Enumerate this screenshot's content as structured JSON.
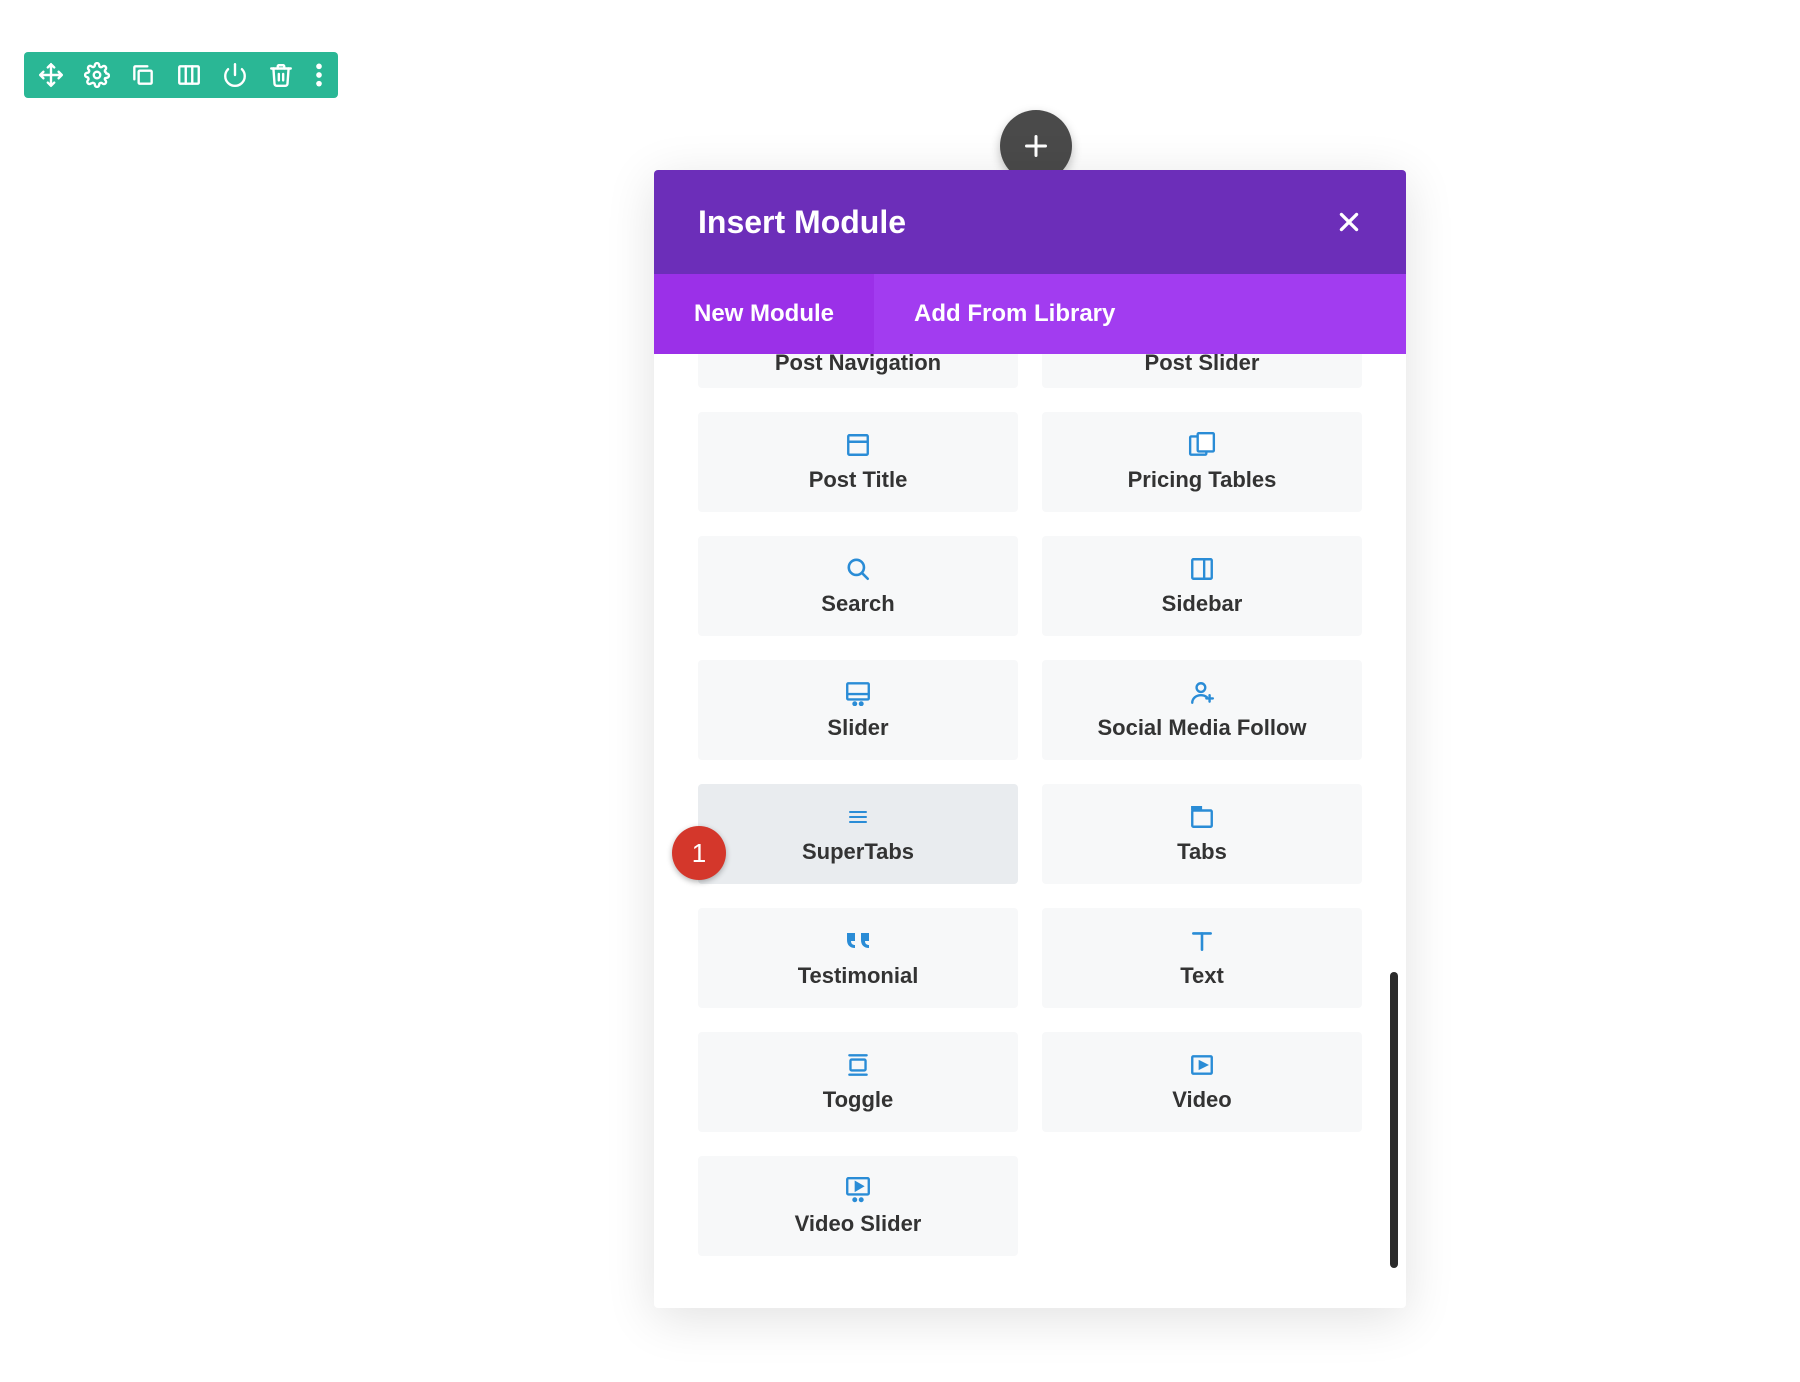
{
  "modal": {
    "title": "Insert Module",
    "tabs": [
      {
        "label": "New Module",
        "active": true
      },
      {
        "label": "Add From Library",
        "active": false
      }
    ],
    "modules": [
      {
        "label": "Post Navigation",
        "icon": "none"
      },
      {
        "label": "Post Slider",
        "icon": "none"
      },
      {
        "label": "Post Title",
        "icon": "post-title"
      },
      {
        "label": "Pricing Tables",
        "icon": "pricing-tables"
      },
      {
        "label": "Search",
        "icon": "search"
      },
      {
        "label": "Sidebar",
        "icon": "sidebar"
      },
      {
        "label": "Slider",
        "icon": "slider"
      },
      {
        "label": "Social Media Follow",
        "icon": "social"
      },
      {
        "label": "SuperTabs",
        "icon": "supertabs",
        "highlight": true
      },
      {
        "label": "Tabs",
        "icon": "tabs"
      },
      {
        "label": "Testimonial",
        "icon": "testimonial"
      },
      {
        "label": "Text",
        "icon": "text"
      },
      {
        "label": "Toggle",
        "icon": "toggle"
      },
      {
        "label": "Video",
        "icon": "video"
      },
      {
        "label": "Video Slider",
        "icon": "video-slider"
      }
    ]
  },
  "badge": {
    "number": "1"
  },
  "toolbar": {
    "items": [
      "move",
      "settings",
      "duplicate",
      "columns",
      "power",
      "delete",
      "more"
    ]
  }
}
